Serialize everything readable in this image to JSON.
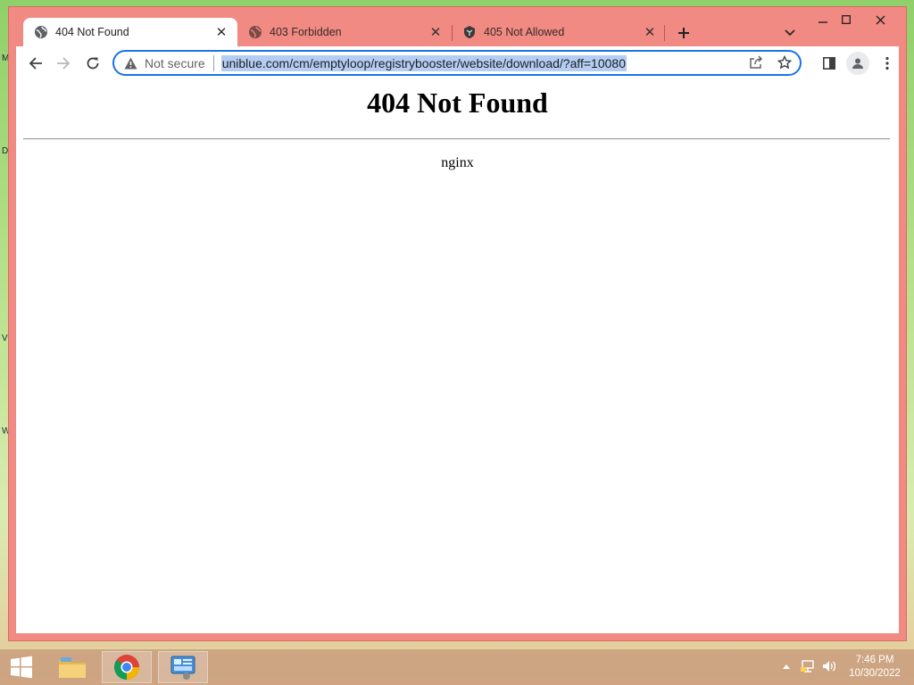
{
  "desktop": {
    "edge_letters": [
      "M",
      "D",
      "V",
      "W"
    ]
  },
  "browser": {
    "tabs": [
      {
        "title": "404 Not Found",
        "active": true,
        "icon": "globe-icon"
      },
      {
        "title": "403 Forbidden",
        "active": false,
        "icon": "globe-icon"
      },
      {
        "title": "405 Not Allowed",
        "active": false,
        "icon": "shield-icon"
      }
    ],
    "new_tab_symbol": "+",
    "security_label": "Not secure",
    "url": "uniblue.com/cm/emptyloop/registrybooster/website/download/?aff=10080",
    "accent_color": "#1a73e8",
    "frame_color": "#f08a82"
  },
  "page": {
    "heading": "404 Not Found",
    "server": "nginx"
  },
  "taskbar": {
    "time": "7:46 PM",
    "date": "10/30/2022",
    "pinned": [
      "start-button",
      "file-explorer",
      "chrome",
      "control-panel"
    ]
  }
}
